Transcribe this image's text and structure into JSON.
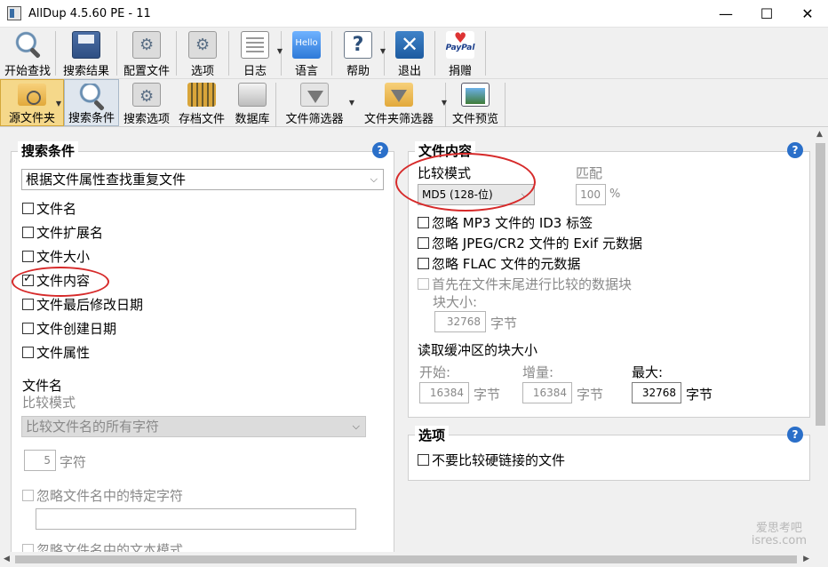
{
  "window": {
    "title": "AllDup 4.5.60 PE - 11",
    "minimize": "—",
    "maximize": "☐",
    "close": "✕"
  },
  "toolbar1": [
    {
      "label": "开始查找",
      "icon": "magnifier-icon"
    },
    {
      "label": "搜索结果",
      "icon": "save-disk-icon"
    },
    {
      "label": "配置文件",
      "icon": "config-gear-icon"
    },
    {
      "label": "选项",
      "icon": "options-icon"
    },
    {
      "label": "日志",
      "icon": "log-document-icon"
    },
    {
      "label": "语言",
      "icon": "hello-language-icon",
      "badge": "Hello"
    },
    {
      "label": "帮助",
      "icon": "help-icon",
      "badge": "?"
    },
    {
      "label": "退出",
      "icon": "exit-icon",
      "badge": "✕"
    },
    {
      "label": "捐赠",
      "icon": "paypal-icon",
      "badge": "PayPal"
    }
  ],
  "toolbar2": [
    {
      "label": "源文件夹",
      "icon": "source-folder-icon"
    },
    {
      "label": "搜索条件",
      "icon": "search-criteria-icon"
    },
    {
      "label": "搜索选项",
      "icon": "search-options-icon"
    },
    {
      "label": "存档文件",
      "icon": "archive-icon"
    },
    {
      "label": "数据库",
      "icon": "database-icon"
    },
    {
      "label": "文件筛选器",
      "icon": "file-filter-icon"
    },
    {
      "label": "文件夹筛选器",
      "icon": "folder-filter-icon"
    },
    {
      "label": "文件预览",
      "icon": "file-preview-icon"
    }
  ],
  "left": {
    "title": "搜索条件",
    "method": "根据文件属性查找重复文件",
    "criteria": [
      {
        "label": "文件名",
        "checked": false
      },
      {
        "label": "文件扩展名",
        "checked": false
      },
      {
        "label": "文件大小",
        "checked": false
      },
      {
        "label": "文件内容",
        "checked": true
      },
      {
        "label": "文件最后修改日期",
        "checked": false
      },
      {
        "label": "文件创建日期",
        "checked": false
      },
      {
        "label": "文件属性",
        "checked": false
      }
    ],
    "filename_heading": "文件名",
    "compare_mode_label": "比较模式",
    "compare_mode_value": "比较文件名的所有字符",
    "chars_value": "5",
    "chars_unit": "字符",
    "ignore_chars_label": "忽略文件名中的特定字符",
    "ignore_pattern_label": "忽略文件名中的文本模式"
  },
  "right": {
    "content_title": "文件内容",
    "compare_mode_label": "比较模式",
    "compare_mode_value": "MD5 (128-位)",
    "match_label": "匹配",
    "match_value": "100",
    "match_unit": "%",
    "options": [
      {
        "label": "忽略 MP3 文件的 ID3 标签",
        "disabled": false
      },
      {
        "label": "忽略 JPEG/CR2 文件的 Exif 元数据",
        "disabled": false
      },
      {
        "label": "忽略 FLAC 文件的元数据",
        "disabled": false
      },
      {
        "label": "首先在文件末尾进行比较的数据块",
        "disabled": true
      }
    ],
    "block_size_label": "块大小:",
    "block_size_value": "32768",
    "byte_unit": "字节",
    "buffer_label": "读取缓冲区的块大小",
    "start_label": "开始:",
    "start_value": "16384",
    "inc_label": "增量:",
    "inc_value": "16384",
    "max_label": "最大:",
    "max_value": "32768",
    "options_title": "选项",
    "hardlink_label": "不要比较硬链接的文件"
  },
  "watermark": {
    "line1": "爱思考吧",
    "line2": "isres.com"
  }
}
